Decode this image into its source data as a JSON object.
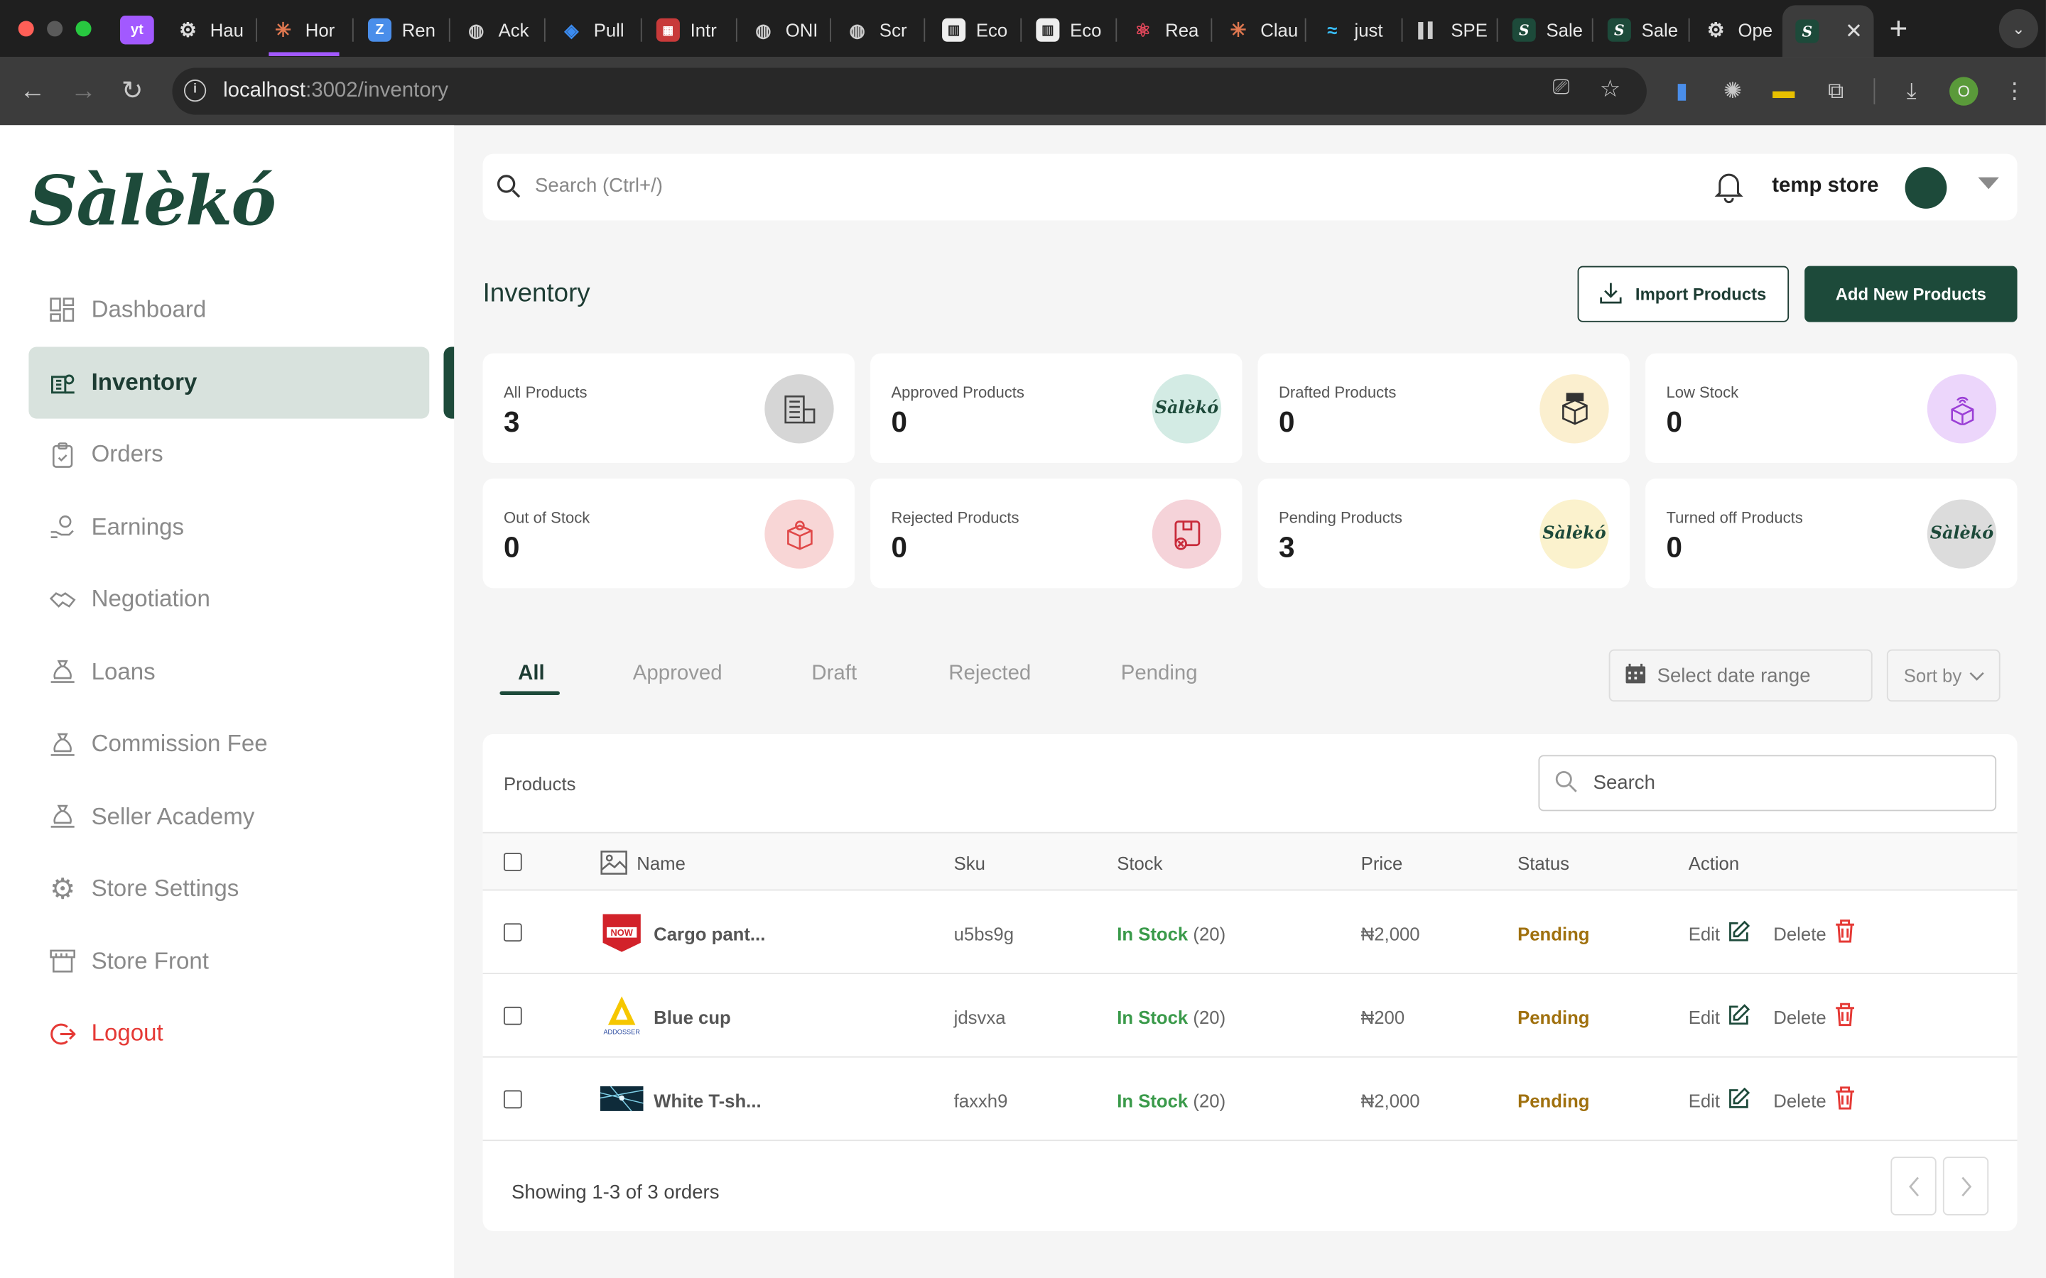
{
  "browser": {
    "tabs": [
      {
        "label": "",
        "icon": "yt-icon",
        "color": "#a259ff"
      },
      {
        "label": "Hau",
        "icon": "openai-icon"
      },
      {
        "label": "Hor",
        "icon": "claude-icon"
      },
      {
        "label": "Ren",
        "icon": "z-icon"
      },
      {
        "label": "Ack",
        "icon": "globe-icon"
      },
      {
        "label": "Pull",
        "icon": "azure-icon"
      },
      {
        "label": "Intr",
        "icon": "calendar-icon"
      },
      {
        "label": "ONI",
        "icon": "globe-icon"
      },
      {
        "label": "Scr",
        "icon": "globe-icon"
      },
      {
        "label": "Eco",
        "icon": "map-icon"
      },
      {
        "label": "Eco",
        "icon": "map-icon"
      },
      {
        "label": "Rea",
        "icon": "react-icon"
      },
      {
        "label": "Clau",
        "icon": "claude-icon"
      },
      {
        "label": "just",
        "icon": "tailwind-icon"
      },
      {
        "label": "SPE",
        "icon": "waveform-icon"
      },
      {
        "label": "Sale",
        "icon": "saleko-icon"
      },
      {
        "label": "Sale",
        "icon": "saleko-icon"
      },
      {
        "label": "Ope",
        "icon": "openai-icon"
      },
      {
        "label": "",
        "icon": "saleko-icon"
      }
    ],
    "url_host": "localhost",
    "url_path": ":3002/inventory",
    "profile_initial": "O"
  },
  "brand": {
    "logo_text": "Sàlèkó",
    "color": "#1d4a3a"
  },
  "sidebar": {
    "items": [
      {
        "label": "Dashboard",
        "icon": "grid-icon"
      },
      {
        "label": "Inventory",
        "icon": "inventory-icon"
      },
      {
        "label": "Orders",
        "icon": "clipboard-icon"
      },
      {
        "label": "Earnings",
        "icon": "hand-coin-icon"
      },
      {
        "label": "Negotiation",
        "icon": "handshake-icon"
      },
      {
        "label": "Loans",
        "icon": "money-bag-icon"
      },
      {
        "label": "Commission Fee",
        "icon": "money-bag-icon"
      },
      {
        "label": "Seller Academy",
        "icon": "money-bag-icon"
      },
      {
        "label": "Store Settings",
        "icon": "gear-icon"
      },
      {
        "label": "Store Front",
        "icon": "store-icon"
      }
    ],
    "logout": "Logout"
  },
  "topbar": {
    "search_placeholder": "Search (Ctrl+/)",
    "store_name": "temp store"
  },
  "page": {
    "title": "Inventory",
    "import_button": "Import Products",
    "add_button": "Add New Products"
  },
  "stats": [
    {
      "label": "All Products",
      "value": "3",
      "bg": "#d6d6d6"
    },
    {
      "label": "Approved Products",
      "value": "0",
      "bg": "#d3ebe4"
    },
    {
      "label": "Drafted Products",
      "value": "0",
      "bg": "#fbefcf"
    },
    {
      "label": "Low Stock",
      "value": "0",
      "bg": "#ecd6fb"
    },
    {
      "label": "Out of Stock",
      "value": "0",
      "bg": "#f8d6d6"
    },
    {
      "label": "Rejected Products",
      "value": "0",
      "bg": "#f5d3d9"
    },
    {
      "label": "Pending Products",
      "value": "3",
      "bg": "#fbf2cd"
    },
    {
      "label": "Turned off Products",
      "value": "0",
      "bg": "#dcdcdc"
    }
  ],
  "stat_icon_text": "Sàlèkó",
  "filter_tabs": [
    "All",
    "Approved",
    "Draft",
    "Rejected",
    "Pending"
  ],
  "filters": {
    "date_range_placeholder": "Select date range",
    "sort_by": "Sort by"
  },
  "table": {
    "section_label": "Products",
    "search_placeholder": "Search",
    "columns": [
      "Name",
      "Sku",
      "Stock",
      "Price",
      "Status",
      "Action"
    ],
    "rows": [
      {
        "name": "Cargo pant...",
        "sku": "u5bs9g",
        "stock_status": "In Stock",
        "stock_count": "(20)",
        "price": "₦2,000",
        "status": "Pending",
        "thumb": "subscribe-now"
      },
      {
        "name": "Blue cup",
        "sku": "jdsvxa",
        "stock_status": "In Stock",
        "stock_count": "(20)",
        "price": "₦200",
        "status": "Pending",
        "thumb": "addosser"
      },
      {
        "name": "White T-sh...",
        "sku": "faxxh9",
        "stock_status": "In Stock",
        "stock_count": "(20)",
        "price": "₦2,000",
        "status": "Pending",
        "thumb": "landscape"
      }
    ],
    "edit_label": "Edit",
    "delete_label": "Delete",
    "footer": "Showing 1-3 of 3 orders"
  }
}
